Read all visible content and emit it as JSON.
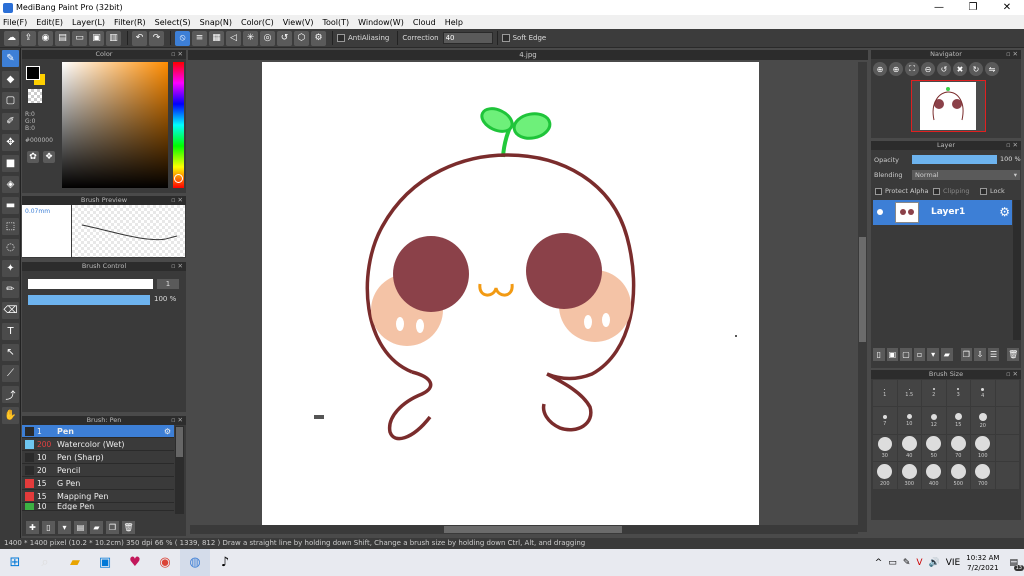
{
  "window": {
    "title": "MediBang Paint Pro (32bit)"
  },
  "menu": [
    "File(F)",
    "Edit(E)",
    "Layer(L)",
    "Filter(R)",
    "Select(S)",
    "Snap(N)",
    "Color(C)",
    "View(V)",
    "Tool(T)",
    "Window(W)",
    "Cloud",
    "Help"
  ],
  "toolbar": {
    "antialiasing_label": "AntiAliasing",
    "correction_label": "Correction",
    "correction_value": "40",
    "soft_edge_label": "Soft Edge"
  },
  "color_panel": {
    "title": "Color",
    "r": "R:0",
    "g": "G:0",
    "b": "B:0",
    "hex": "#000000",
    "fg_color": "#000000",
    "bg_color": "#ffd000"
  },
  "brush_preview": {
    "title": "Brush Preview",
    "size_text": "0.07mm"
  },
  "brush_control": {
    "title": "Brush Control",
    "size_value": "1",
    "opacity_value": "100 %"
  },
  "brush_list": {
    "title": "Brush: Pen",
    "items": [
      {
        "num": "1",
        "name": "Pen",
        "color": "#2a2a2a"
      },
      {
        "num": "200",
        "name": "Watercolor (Wet)",
        "color": "#6ec6f0"
      },
      {
        "num": "10",
        "name": "Pen (Sharp)",
        "color": "#2a2a2a"
      },
      {
        "num": "20",
        "name": "Pencil",
        "color": "#2a2a2a"
      },
      {
        "num": "15",
        "name": "G Pen",
        "color": "#e33b3b"
      },
      {
        "num": "15",
        "name": "Mapping Pen",
        "color": "#e33b3b"
      },
      {
        "num": "10",
        "name": "Edge Pen",
        "color": "#3cb043"
      }
    ]
  },
  "document": {
    "tab": "4.jpg"
  },
  "navigator": {
    "title": "Navigator"
  },
  "layer_panel": {
    "title": "Layer",
    "opacity_label": "Opacity",
    "opacity_value": "100 %",
    "blending_label": "Blending",
    "blending_value": "Normal",
    "protect_alpha": "Protect Alpha",
    "clipping": "Clipping",
    "lock": "Lock",
    "layer_name": "Layer1"
  },
  "brush_size": {
    "title": "Brush Size",
    "sizes": [
      "1",
      "1.5",
      "2",
      "3",
      "4",
      "7",
      "10",
      "12",
      "15",
      "20",
      "30",
      "40",
      "50",
      "70",
      "100",
      "200",
      "300",
      "400",
      "500",
      "700"
    ]
  },
  "status": {
    "text": "1400 * 1400 pixel   (10.2 * 10.2cm)   350 dpi   66 %   ( 1339, 812 )   Draw a straight line by holding down Shift, Change a brush size by holding down Ctrl, Alt, and dragging"
  },
  "taskbar": {
    "lang": "VIE",
    "time": "10:32 AM",
    "date": "7/2/2021",
    "notif": "13"
  }
}
